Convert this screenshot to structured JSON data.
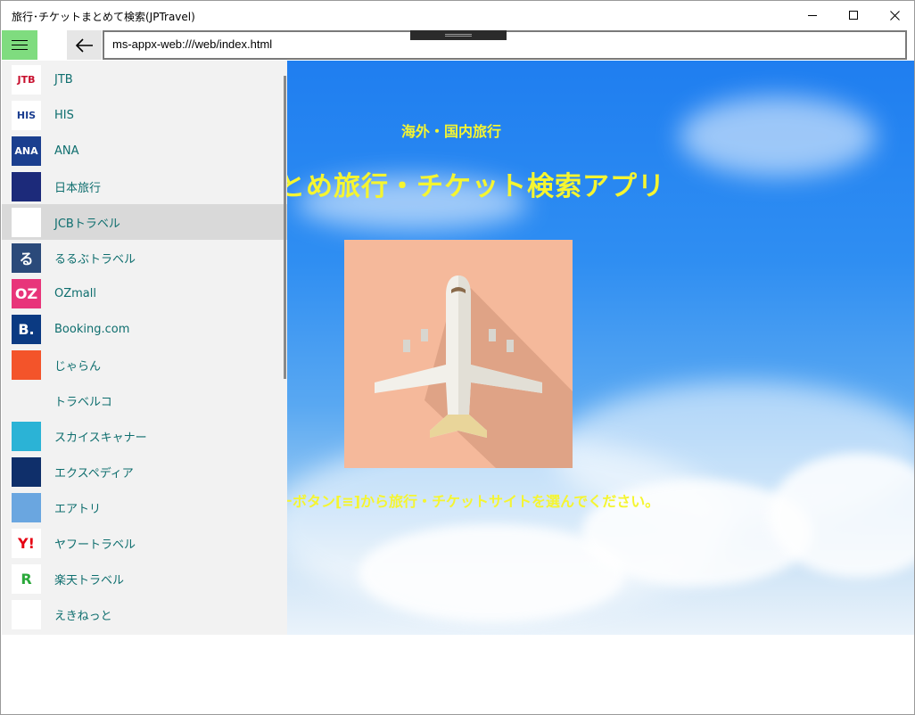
{
  "window": {
    "title": "旅行･チケットまとめて検索(JPTravel)"
  },
  "toolbar": {
    "url": "ms-appx-web:///web/index.html"
  },
  "page": {
    "subtitle": "海外・国内旅行",
    "title": "とめ旅行・チケット検索アプリ",
    "instruction": "ーボタン[≡]から旅行・チケットサイトを選んでください。"
  },
  "menu": {
    "items": [
      {
        "label": "JTB",
        "icon": "jtb-logo-icon",
        "icon_text": "JTB",
        "icon_bg": "#ffffff",
        "icon_fg": "#c8102e"
      },
      {
        "label": "HIS",
        "icon": "his-logo-icon",
        "icon_text": "HIS",
        "icon_bg": "#ffffff",
        "icon_fg": "#1a3d8f"
      },
      {
        "label": "ANA",
        "icon": "ana-logo-icon",
        "icon_text": "ANA",
        "icon_bg": "#1b3f8f",
        "icon_fg": "#ffffff"
      },
      {
        "label": "日本旅行",
        "icon": "nihon-ryoko-logo-icon",
        "icon_text": "",
        "icon_bg": "#1c2a7a",
        "icon_fg": "#ffffff"
      },
      {
        "label": "JCBトラベル",
        "icon": "jcb-travel-logo-icon",
        "icon_text": "",
        "icon_bg": "#ffffff",
        "icon_fg": "#333333"
      },
      {
        "label": "るるぶトラベル",
        "icon": "rurubu-logo-icon",
        "icon_text": "る",
        "icon_bg": "#2b4a7a",
        "icon_fg": "#ffffff"
      },
      {
        "label": "OZmall",
        "icon": "ozmall-logo-icon",
        "icon_text": "OZ",
        "icon_bg": "#e8357a",
        "icon_fg": "#ffffff"
      },
      {
        "label": "Booking.com",
        "icon": "booking-logo-icon",
        "icon_text": "B.",
        "icon_bg": "#0b3a82",
        "icon_fg": "#ffffff"
      },
      {
        "label": "じゃらん",
        "icon": "jalan-logo-icon",
        "icon_text": "",
        "icon_bg": "#f3542a",
        "icon_fg": "#ffffff"
      },
      {
        "label": "トラベルコ",
        "icon": "travelko-logo-icon",
        "icon_text": "",
        "icon_bg": "#f2f2f2",
        "icon_fg": "#e23b2a"
      },
      {
        "label": "スカイスキャナー",
        "icon": "skyscanner-logo-icon",
        "icon_text": "",
        "icon_bg": "#2bb3d6",
        "icon_fg": "#ffffff"
      },
      {
        "label": "エクスペディア",
        "icon": "expedia-logo-icon",
        "icon_text": "",
        "icon_bg": "#0f2f6a",
        "icon_fg": "#f5c518"
      },
      {
        "label": "エアトリ",
        "icon": "airtrip-logo-icon",
        "icon_text": "",
        "icon_bg": "#6aa6e0",
        "icon_fg": "#1c2a4a"
      },
      {
        "label": "ヤフートラベル",
        "icon": "yahoo-travel-logo-icon",
        "icon_text": "Y!",
        "icon_bg": "#ffffff",
        "icon_fg": "#e60012"
      },
      {
        "label": "楽天トラベル",
        "icon": "rakuten-travel-logo-icon",
        "icon_text": "R",
        "icon_bg": "#ffffff",
        "icon_fg": "#2aa83a"
      },
      {
        "label": "えきねっと",
        "icon": "ekinet-logo-icon",
        "icon_text": "",
        "icon_bg": "#ffffff",
        "icon_fg": "#1b9a4a"
      }
    ],
    "selected_index": 4
  },
  "colors": {
    "hamburger_bg": "#7fdc7f",
    "heading_yellow": "#f5f530",
    "menu_text": "#0e6e6e",
    "sky_top": "#1f7ef0"
  }
}
